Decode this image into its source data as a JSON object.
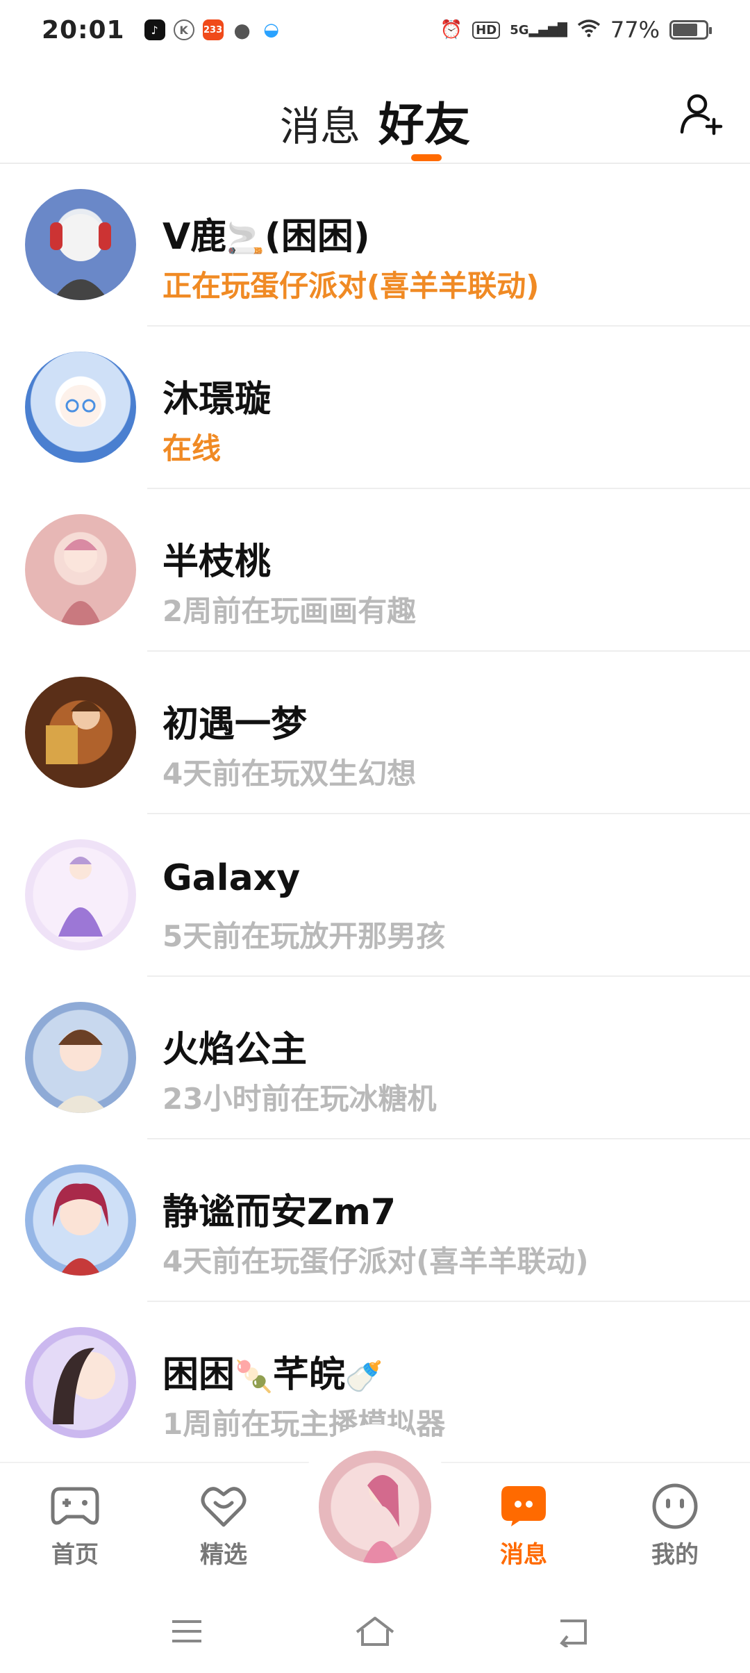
{
  "status_bar": {
    "time": "20:01",
    "apps": [
      "tiktok-icon",
      "k-app-icon",
      "233-app-icon",
      "chat-bubble-icon",
      "cloud-icon"
    ],
    "app_233_label": "233",
    "app_k_label": "K",
    "signal_label": "5G",
    "hd_label": "HD",
    "battery_percent": "77%",
    "battery_level": 0.77
  },
  "header": {
    "tabs": [
      {
        "label": "消息",
        "active": false
      },
      {
        "label": "好友",
        "active": true
      }
    ],
    "add_friend_icon": "add-user-icon",
    "accent_color": "#ff6a00"
  },
  "friends": [
    {
      "name": "V鹿",
      "name_suffix": "(困困)",
      "name_emoji": "🚬",
      "status": "正在玩蛋仔派对(喜羊羊联动)",
      "online": true
    },
    {
      "name": "沐璟璇",
      "status": "在线",
      "online": true
    },
    {
      "name": "半枝桃",
      "status": "2周前在玩画画有趣",
      "online": false
    },
    {
      "name": "初遇一梦",
      "status": "4天前在玩双生幻想",
      "online": false
    },
    {
      "name": "Galaxy",
      "status": "5天前在玩放开那男孩",
      "online": false
    },
    {
      "name": "火焰公主",
      "status": "23小时前在玩冰糖机",
      "online": false
    },
    {
      "name": "静谧而安Zm7",
      "status": "4天前在玩蛋仔派对(喜羊羊联动)",
      "online": false
    },
    {
      "name": "困困",
      "name_emoji": "🍡",
      "name_mid": "芊皖",
      "name_emoji2": "🍼",
      "status": "1周前在玩主播模拟器",
      "online": false
    }
  ],
  "bottom_nav": {
    "items": [
      {
        "label": "首页",
        "icon": "gamepad-icon",
        "active": false
      },
      {
        "label": "精选",
        "icon": "heart-badge-icon",
        "active": false
      },
      {
        "label": "消息",
        "icon": "message-icon",
        "active": true
      },
      {
        "label": "我的",
        "icon": "smiley-icon",
        "active": false
      }
    ]
  },
  "system_nav": {
    "buttons": [
      "menu-icon",
      "home-icon",
      "back-icon"
    ]
  }
}
